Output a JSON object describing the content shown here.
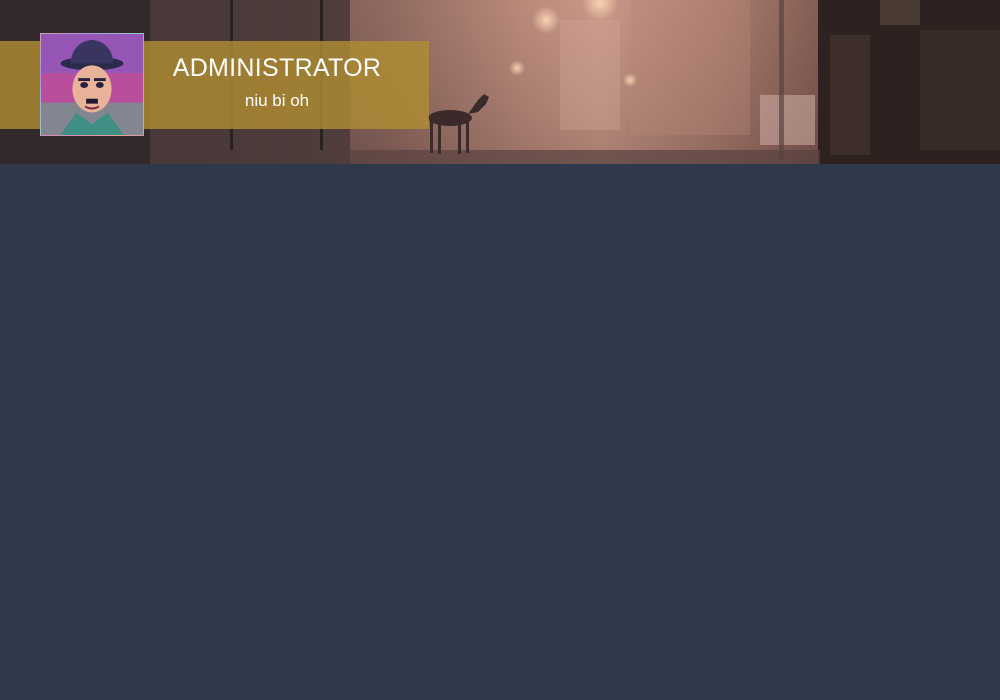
{
  "header": {
    "user_title": "ADMINISTRATOR",
    "user_subtitle": "niu bi oh",
    "background_image": "foggy-street-with-foal-photo",
    "band_color": "#b08c32"
  },
  "avatar": {
    "image": "man-in-bowler-hat-pop-art-portrait"
  },
  "colors": {
    "page_background": "#2e3a4b",
    "text": "#ffffff"
  }
}
